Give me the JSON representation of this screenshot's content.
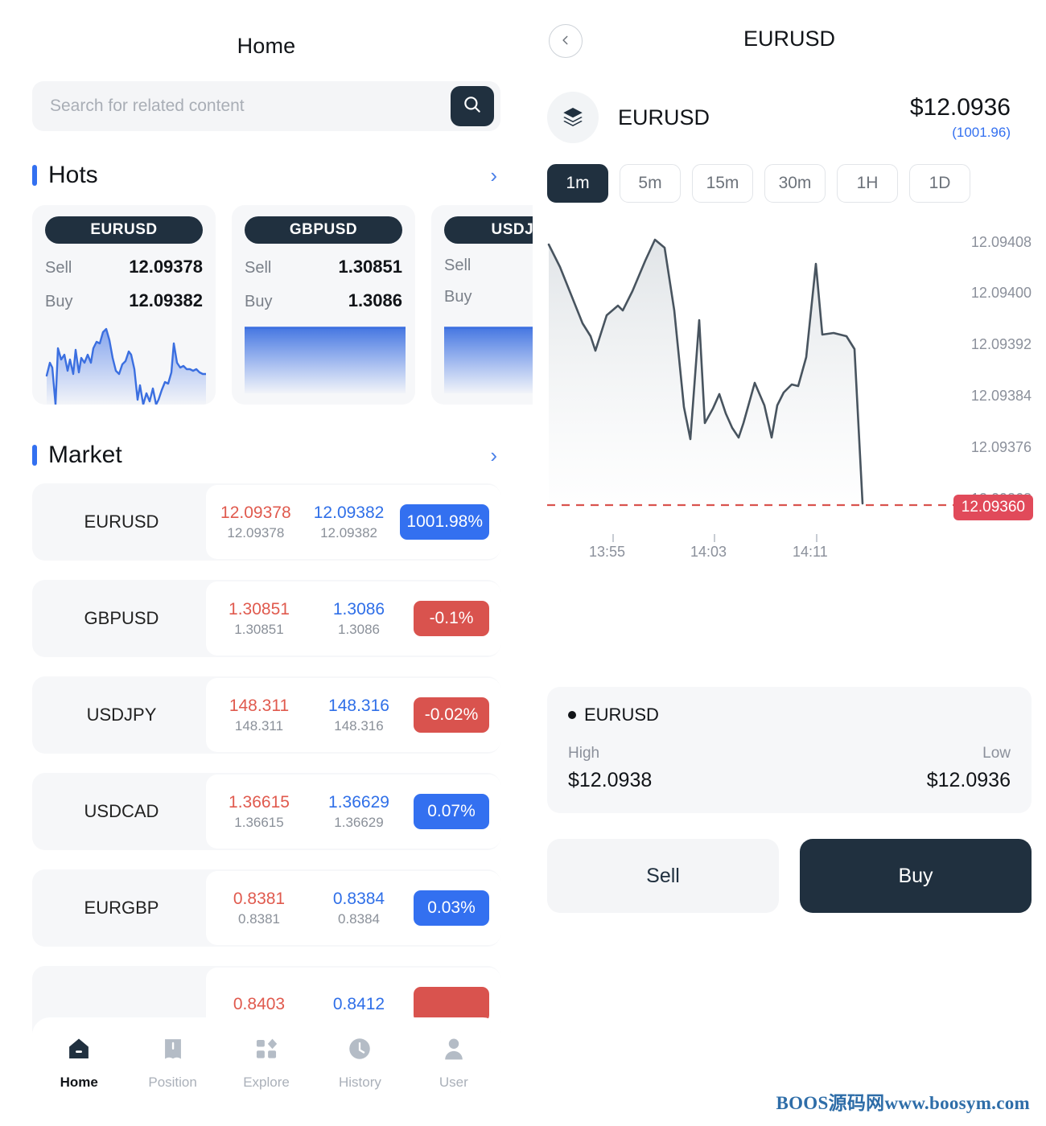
{
  "left": {
    "title": "Home",
    "search": {
      "placeholder": "Search for related content",
      "value": "",
      "icon": "search-icon"
    },
    "hots": {
      "title": "Hots",
      "arrow": "›"
    },
    "hot_cards": [
      {
        "symbol": "EURUSD",
        "sell_label": "Sell",
        "sell": "12.09378",
        "buy_label": "Buy",
        "buy": "12.09382",
        "spark": "detailed"
      },
      {
        "symbol": "GBPUSD",
        "sell_label": "Sell",
        "sell": "1.30851",
        "buy_label": "Buy",
        "buy": "1.3086",
        "spark": "flat"
      },
      {
        "symbol": "USDJPY",
        "sell_label": "Sell",
        "sell": "",
        "buy_label": "Buy",
        "buy": "",
        "spark": "flat"
      }
    ],
    "market": {
      "title": "Market",
      "arrow": "›"
    },
    "market_rows": [
      {
        "symbol": "EURUSD",
        "sell": "12.09378",
        "sell_sub": "12.09378",
        "buy": "12.09382",
        "buy_sub": "12.09382",
        "change": "1001.98%",
        "dir": "up"
      },
      {
        "symbol": "GBPUSD",
        "sell": "1.30851",
        "sell_sub": "1.30851",
        "buy": "1.3086",
        "buy_sub": "1.3086",
        "change": "-0.1%",
        "dir": "down"
      },
      {
        "symbol": "USDJPY",
        "sell": "148.311",
        "sell_sub": "148.311",
        "buy": "148.316",
        "buy_sub": "148.316",
        "change": "-0.02%",
        "dir": "down"
      },
      {
        "symbol": "USDCAD",
        "sell": "1.36615",
        "sell_sub": "1.36615",
        "buy": "1.36629",
        "buy_sub": "1.36629",
        "change": "0.07%",
        "dir": "up"
      },
      {
        "symbol": "EURGBP",
        "sell": "0.8381",
        "sell_sub": "0.8381",
        "buy": "0.8384",
        "buy_sub": "0.8384",
        "change": "0.03%",
        "dir": "up"
      },
      {
        "symbol": "",
        "sell": "0.8403",
        "sell_sub": "",
        "buy": "0.8412",
        "buy_sub": "",
        "change": "",
        "dir": "down"
      }
    ],
    "nav": [
      {
        "label": "Home",
        "icon": "home-icon",
        "active": true
      },
      {
        "label": "Position",
        "icon": "book-icon",
        "active": false
      },
      {
        "label": "Explore",
        "icon": "grid-icon",
        "active": false
      },
      {
        "label": "History",
        "icon": "clock-icon",
        "active": false
      },
      {
        "label": "User",
        "icon": "user-icon",
        "active": false
      }
    ]
  },
  "right": {
    "back_icon": "chevron-left-icon",
    "title": "EURUSD",
    "symbol": {
      "icon": "layers-icon",
      "name": "EURUSD",
      "price": "$12.0936",
      "sub": "(1001.96)"
    },
    "timeframes": [
      {
        "label": "1m",
        "active": true
      },
      {
        "label": "5m",
        "active": false
      },
      {
        "label": "15m",
        "active": false
      },
      {
        "label": "30m",
        "active": false
      },
      {
        "label": "1H",
        "active": false
      },
      {
        "label": "1D",
        "active": false
      }
    ],
    "info": {
      "title": "EURUSD",
      "high_label": "High",
      "high_value": "$12.0938",
      "low_label": "Low",
      "low_value": "$12.0936"
    },
    "actions": {
      "sell": "Sell",
      "buy": "Buy"
    }
  },
  "watermark": "BOOS源码网www.boosym.com",
  "colors": {
    "navy": "#20303f",
    "blue": "#3370f0",
    "red": "#d9534e",
    "price_tag_red": "#e14a5a",
    "muted": "#8b909b"
  },
  "chart_data": {
    "type": "line",
    "title": "EURUSD",
    "xlabel": "",
    "ylabel": "",
    "grid": false,
    "legend": "none",
    "ylim": [
      12.0936,
      12.09412
    ],
    "yticks": [
      "12.09408",
      "12.09400",
      "12.09392",
      "12.09384",
      "12.09376",
      "12.09368"
    ],
    "ytick_values": [
      12.09408,
      12.094,
      12.09392,
      12.09384,
      12.09376,
      12.09368
    ],
    "xticks": [
      "13:55",
      "14:03",
      "14:11"
    ],
    "marker_line": {
      "value": "12.09360",
      "color": "#e14a5a",
      "style": "dashed"
    },
    "x": [
      0,
      1,
      2,
      3,
      4,
      5,
      6,
      7,
      8,
      9,
      10,
      11,
      12,
      13,
      14,
      15,
      16,
      17,
      18,
      19,
      20,
      21,
      22,
      23,
      24,
      25,
      26,
      27,
      28,
      29,
      30,
      31,
      32,
      33,
      34,
      35,
      36,
      37,
      38,
      39,
      40,
      41,
      42
    ],
    "values": [
      12.094105,
      12.094085,
      12.09396,
      12.0939,
      12.093845,
      12.093895,
      12.09392,
      12.093912,
      12.093955,
      12.094022,
      12.094055,
      12.094035,
      12.09387,
      12.09371,
      12.093655,
      12.0938,
      12.093675,
      12.09372,
      12.093702,
      12.093655,
      12.09364,
      12.0937,
      12.093742,
      12.09368,
      12.093612,
      12.093715,
      12.09376,
      12.0938,
      12.09383,
      12.093828,
      12.09388,
      12.09405,
      12.093905,
      12.093908,
      12.093898,
      12.09388,
      12.0936
    ],
    "series": [
      {
        "name": "EURUSD",
        "color": "#48545f",
        "fill": "#f3f5f6"
      }
    ]
  }
}
